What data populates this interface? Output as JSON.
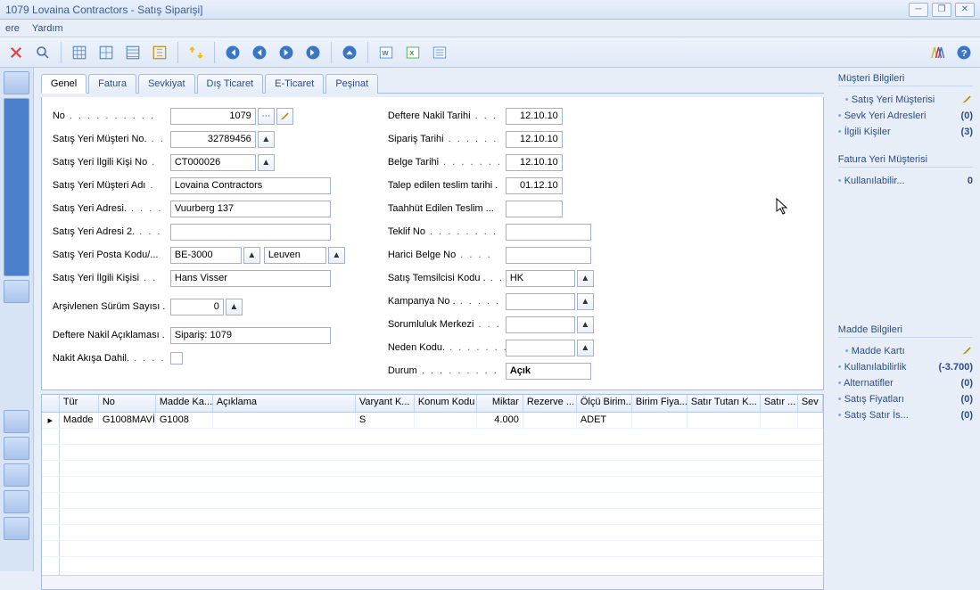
{
  "window": {
    "title": "1079 Lovaina Contractors - Satış Siparişi]"
  },
  "menu": {
    "item1": "ere",
    "item2": "Yardım"
  },
  "tabs": [
    "Genel",
    "Fatura",
    "Sevkiyat",
    "Dış Ticaret",
    "E-Ticaret",
    "Peşinat"
  ],
  "form": {
    "left": {
      "no_label": "No",
      "no": "1079",
      "cust_no_label": "Satış Yeri Müşteri No.",
      "cust_no": "32789456",
      "contact_no_label": "Satış Yeri İlgili Kişi No",
      "contact_no": "CT000026",
      "cust_name_label": "Satış Yeri Müşteri Adı",
      "cust_name": "Lovaina Contractors",
      "addr_label": "Satış Yeri Adresi.",
      "addr": "Vuurberg 137",
      "addr2_label": "Satış Yeri Adresi 2.",
      "addr2": "",
      "postal_label": "Satış Yeri Posta Kodu/...",
      "postal": "BE-3000",
      "city": "Leuven",
      "contact_label": "Satış Yeri İlgili Kişisi",
      "contact": "Hans Visser",
      "arch_label": "Arşivlenen Sürüm Sayısı .",
      "arch": "0",
      "postdesc_label": "Deftere Nakil Açıklaması .",
      "postdesc": "Sipariş: 1079",
      "cashflow_label": "Nakit Akışa Dahil."
    },
    "right": {
      "posting_date_l": "Deftere Nakil Tarihi",
      "posting_date": "12.10.10",
      "order_date_l": "Sipariş Tarihi",
      "order_date": "12.10.10",
      "doc_date_l": "Belge Tarihi",
      "doc_date": "12.10.10",
      "req_deliv_l": "Talep edilen teslim tarihi .",
      "req_deliv": "01.12.10",
      "prom_deliv_l": "Taahhüt Edilen Teslim ...",
      "prom_deliv": "",
      "quote_l": "Teklif No",
      "quote": "",
      "ext_doc_l": "Harici Belge No",
      "ext_doc": "",
      "salesp_l": "Satış Temsilcisi Kodu .",
      "salesp": "HK",
      "campaign_l": "Kampanya No .",
      "campaign": "",
      "resp_l": "Sorumluluk Merkezi",
      "resp": "",
      "reason_l": "Neden Kodu.",
      "reason": "",
      "status_l": "Durum",
      "status": "Açık"
    }
  },
  "grid": {
    "cols": [
      "Tür",
      "No",
      "Madde Ka...",
      "Açıklama",
      "Varyant K...",
      "Konum Kodu",
      "Miktar",
      "Rezerve ...",
      "Ölçü Birim...",
      "Birim Fiya...",
      "Satır Tutarı K...",
      "Satır ...",
      "Sev"
    ],
    "row1": {
      "type": "Madde",
      "no": "G1008MAVİ",
      "cat": "G1008",
      "desc": "",
      "variant": "S",
      "loc": "",
      "qty": "4.000",
      "res": "",
      "uom": "ADET",
      "price": "",
      "amt": "",
      "ln": "",
      "sev": ""
    }
  },
  "side": {
    "sec1_title": "Müşteri Bilgileri",
    "sec1_items": [
      {
        "label": "Satış Yeri Müşterisi",
        "val": "pencil"
      },
      {
        "label": "Sevk Yeri Adresleri",
        "val": "(0)"
      },
      {
        "label": "İlgili Kişiler",
        "val": "(3)"
      }
    ],
    "sec2_title": "Fatura Yeri Müşterisi",
    "sec2_items": [
      {
        "label": "Kullanılabilir...",
        "val": "0"
      }
    ],
    "sec3_title": "Madde Bilgileri",
    "sec3_items": [
      {
        "label": "Madde Kartı",
        "val": "pencil"
      },
      {
        "label": "Kullanılabilirlik",
        "val": "(-3.700)"
      },
      {
        "label": "Alternatifler",
        "val": "(0)"
      },
      {
        "label": "Satış Fiyatları",
        "val": "(0)"
      },
      {
        "label": "Satış Satır İs...",
        "val": "(0)"
      }
    ]
  }
}
